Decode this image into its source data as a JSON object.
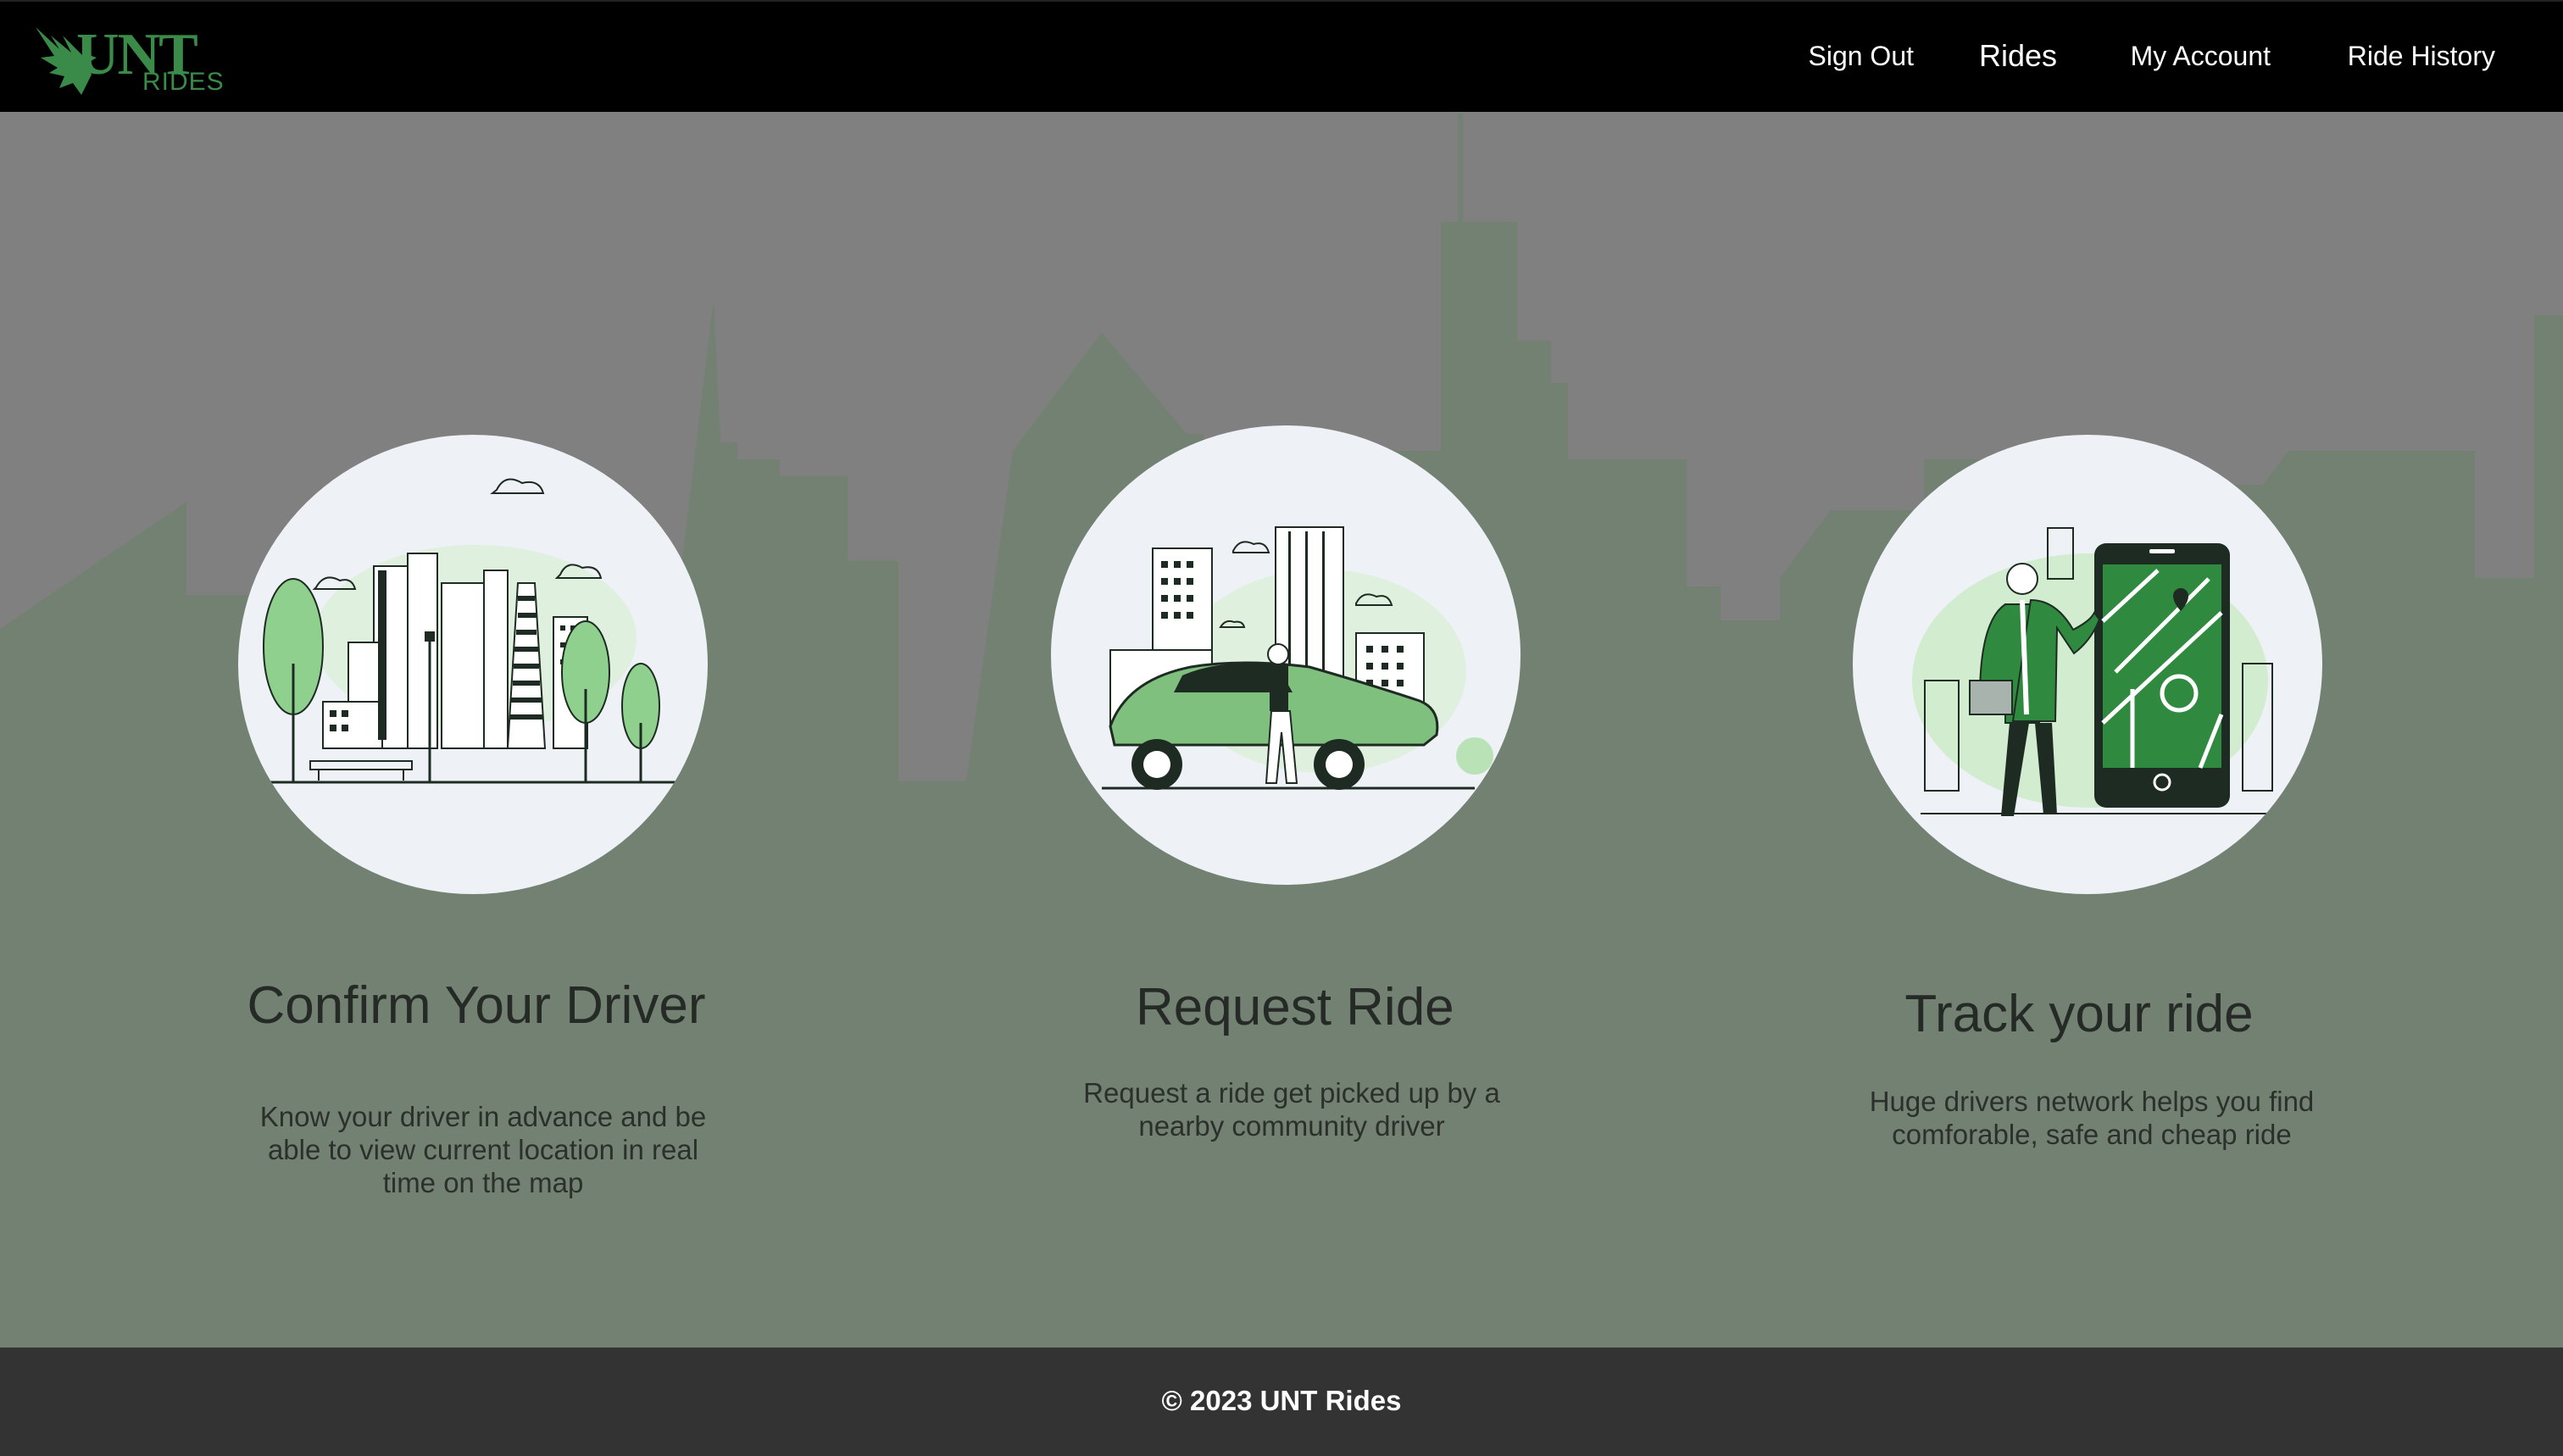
{
  "brand": {
    "logo_text": "UNT",
    "logo_sub": "RIDES",
    "logo_icon": "eagle-icon"
  },
  "nav": {
    "items": [
      {
        "label": "Sign Out"
      },
      {
        "label": "Rides"
      },
      {
        "label": "My Account"
      },
      {
        "label": "Ride History"
      }
    ]
  },
  "features": [
    {
      "title": "Confirm Your Driver",
      "text": "Know your driver in advance and be able to view current location in real time on the map",
      "illustration": "city-park-illustration"
    },
    {
      "title": "Request Ride",
      "text": "Request a ride get picked up by a nearby community driver",
      "illustration": "car-driver-illustration"
    },
    {
      "title": "Track your ride",
      "text": "Huge drivers network helps you find comforable, safe and cheap ride",
      "illustration": "phone-map-illustration"
    }
  ],
  "footer": {
    "copyright": "© 2023 UNT Rides"
  },
  "colors": {
    "navbar": "#000000",
    "brand_green": "#3a8b4a",
    "hero_bg_top": "#808080",
    "hero_bg_bottom": "#737f72",
    "footer": "#333333"
  }
}
